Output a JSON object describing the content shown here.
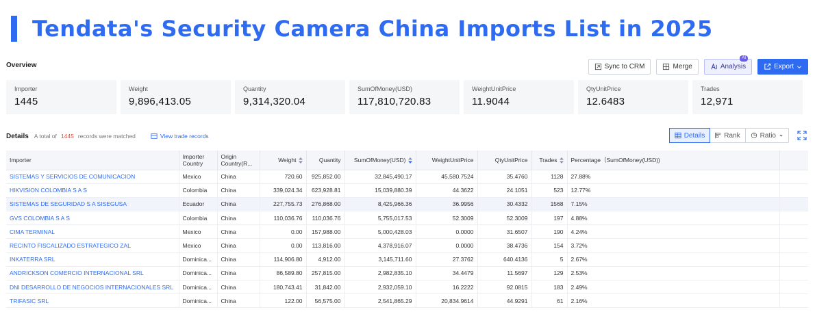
{
  "title": "Tendata's Security Camera China Imports List in 2025",
  "overview_label": "Overview",
  "toolbar": {
    "sync_label": "Sync to CRM",
    "merge_label": "Merge",
    "analysis_label": "Analysis",
    "ai_badge": "AI",
    "export_label": "Export"
  },
  "stats": [
    {
      "label": "Importer",
      "value": "1445"
    },
    {
      "label": "Weight",
      "value": "9,896,413.05"
    },
    {
      "label": "Quantity",
      "value": "9,314,320.04"
    },
    {
      "label": "SumOfMoney(USD)",
      "value": "117,810,720.83"
    },
    {
      "label": "WeightUnitPrice",
      "value": "11.9044"
    },
    {
      "label": "QtyUnitPrice",
      "value": "12.6483"
    },
    {
      "label": "Trades",
      "value": "12,971"
    }
  ],
  "details": {
    "title": "Details",
    "prefix": "A total of",
    "count": "1445",
    "suffix": "records were matched",
    "view_link": "View trade records",
    "view_details": "Details",
    "view_rank": "Rank",
    "view_ratio": "Ratio"
  },
  "columns": {
    "importer": "Importer",
    "importer_country": "Importer Country",
    "origin_country": "Origin Country(R...",
    "weight": "Weight",
    "quantity": "Quantity",
    "sum": "SumOfMoney(USD)",
    "wup": "WeightUnitPrice",
    "qup": "QtyUnitPrice",
    "trades": "Trades",
    "pct": "Percentage（SumOfMoney(USD))"
  },
  "rows": [
    {
      "importer": "SISTEMAS Y SERVICIOS DE COMUNICACION",
      "country": "Mexico",
      "origin": "China",
      "weight": "720.60",
      "quantity": "925,852.00",
      "sum": "32,845,490.17",
      "wup": "45,580.7524",
      "qup": "35.4760",
      "trades": "1128",
      "pct": "27.88%"
    },
    {
      "importer": "HIKVISION COLOMBIA S A S",
      "country": "Colombia",
      "origin": "China",
      "weight": "339,024.34",
      "quantity": "623,928.81",
      "sum": "15,039,880.39",
      "wup": "44.3622",
      "qup": "24.1051",
      "trades": "523",
      "pct": "12.77%"
    },
    {
      "importer": "SISTEMAS DE SEGURIDAD S A SISEGUSA",
      "country": "Ecuador",
      "origin": "China",
      "weight": "227,755.73",
      "quantity": "276,868.00",
      "sum": "8,425,966.36",
      "wup": "36.9956",
      "qup": "30.4332",
      "trades": "1568",
      "pct": "7.15%"
    },
    {
      "importer": "GVS COLOMBIA S A S",
      "country": "Colombia",
      "origin": "China",
      "weight": "110,036.76",
      "quantity": "110,036.76",
      "sum": "5,755,017.53",
      "wup": "52.3009",
      "qup": "52.3009",
      "trades": "197",
      "pct": "4.88%"
    },
    {
      "importer": "CIMA TERMINAL",
      "country": "Mexico",
      "origin": "China",
      "weight": "0.00",
      "quantity": "157,988.00",
      "sum": "5,000,428.03",
      "wup": "0.0000",
      "qup": "31.6507",
      "trades": "190",
      "pct": "4.24%"
    },
    {
      "importer": "RECINTO FISCALIZADO ESTRATEGICO ZAL",
      "country": "Mexico",
      "origin": "China",
      "weight": "0.00",
      "quantity": "113,816.00",
      "sum": "4,378,916.07",
      "wup": "0.0000",
      "qup": "38.4736",
      "trades": "154",
      "pct": "3.72%"
    },
    {
      "importer": "INKATERRA SRL",
      "country": "Dominica...",
      "origin": "China",
      "weight": "114,906.80",
      "quantity": "4,912.00",
      "sum": "3,145,711.60",
      "wup": "27.3762",
      "qup": "640.4136",
      "trades": "5",
      "pct": "2.67%"
    },
    {
      "importer": "ANDRICKSON COMERCIO INTERNACIONAL SRL",
      "country": "Dominica...",
      "origin": "China",
      "weight": "86,589.80",
      "quantity": "257,815.00",
      "sum": "2,982,835.10",
      "wup": "34.4479",
      "qup": "11.5697",
      "trades": "129",
      "pct": "2.53%"
    },
    {
      "importer": "DNI DESARROLLO DE NEGOCIOS INTERNACIONALES SRL",
      "country": "Dominica...",
      "origin": "China",
      "weight": "180,743.41",
      "quantity": "31,842.00",
      "sum": "2,932,059.10",
      "wup": "16.2222",
      "qup": "92.0815",
      "trades": "183",
      "pct": "2.49%"
    },
    {
      "importer": "TRIFASIC SRL",
      "country": "Dominica...",
      "origin": "China",
      "weight": "122.00",
      "quantity": "56,575.00",
      "sum": "2,541,865.29",
      "wup": "20,834.9614",
      "qup": "44.9291",
      "trades": "61",
      "pct": "2.16%"
    }
  ]
}
